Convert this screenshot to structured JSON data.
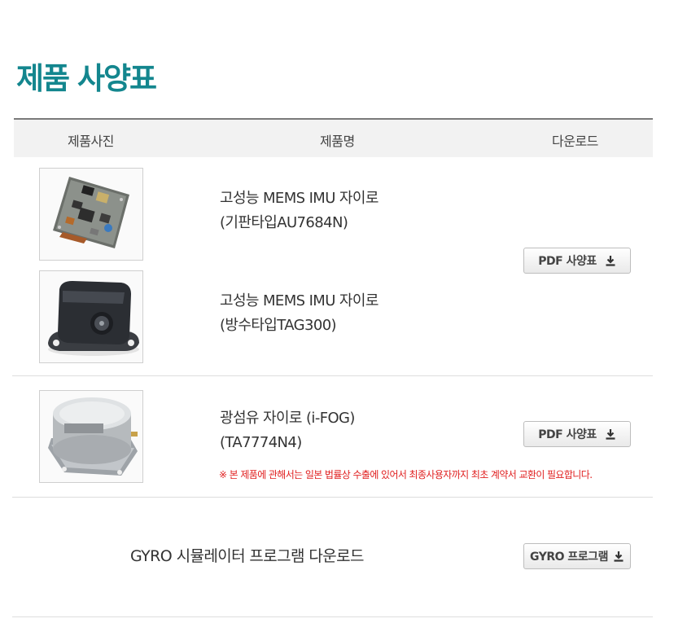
{
  "page_title": "제품 사양표",
  "table_header": {
    "photo": "제품사진",
    "name": "제품명",
    "download": "다운로드"
  },
  "products": [
    {
      "line1": "고성능 MEMS IMU 자이로",
      "line2": "(기판타입AU7684N)",
      "image_icon": "circuit-board-image"
    },
    {
      "line1": "고성능 MEMS IMU 자이로",
      "line2": "(방수타입TAG300)",
      "image_icon": "waterproof-housing-image"
    },
    {
      "line1": "광섬유 자이로 (i-FOG)",
      "line2": "(TA7774N4)",
      "image_icon": "fiber-optic-gyro-image"
    }
  ],
  "buttons": {
    "pdf_spec_1": "PDF 사양표",
    "pdf_spec_2": "PDF 사양표",
    "gyro_program": "GYRO 프로그램"
  },
  "export_notice": "※ 본 제품에 관해서는 일본 법률상 수출에 있어서 최종사용자까지 최초 계약서 교환이 필요합니다.",
  "gyro_simulator": "GYRO 시뮬레이터 프로그램 다운로드",
  "colors": {
    "title": "#13868e",
    "notice": "#e02020",
    "header_bg": "#f2f2f2"
  }
}
